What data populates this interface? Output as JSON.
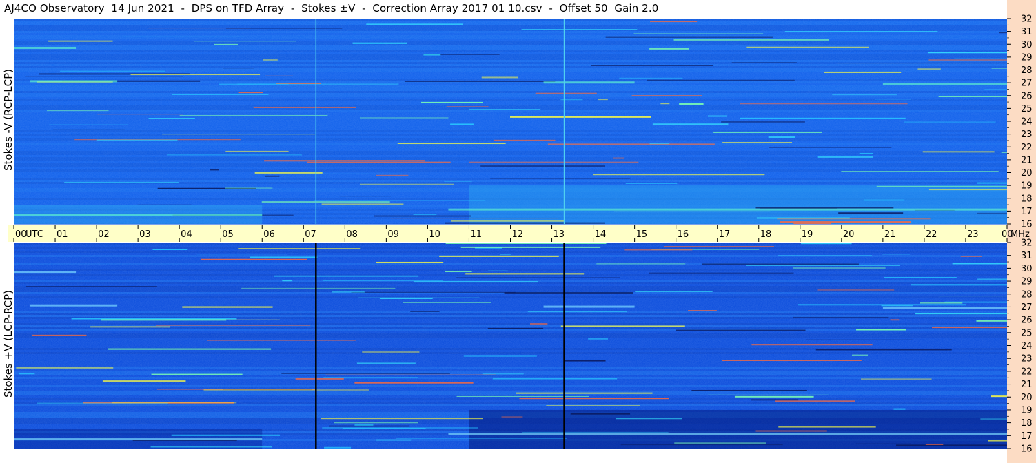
{
  "window": {
    "title": "AJ4CO Observatory  14 Jun 2021  -  DPS on TFD Array  -  Stokes ±V  -  Correction Array 2017 01 10.csv  -  Offset 50  Gain 2.0"
  },
  "colors": {
    "background": "#0a5ae6",
    "band_bg": "#ffffc8",
    "right_strip": "#fcdcc4",
    "marker_top": "#4fd0f0",
    "marker_bottom": "#000000"
  },
  "chart_data": [
    {
      "type": "heatmap",
      "panel": "top",
      "ylabel": "Stokes -V (RCP-LCP)",
      "y_unit": "MHz",
      "ylim": [
        16,
        32
      ],
      "y_ticks": [
        "32",
        "31",
        "30",
        "29",
        "28",
        "27",
        "26",
        "25",
        "24",
        "23",
        "22",
        "21",
        "20",
        "19",
        "18",
        "17",
        "16"
      ],
      "x_range_utc": [
        0,
        24
      ],
      "marker_lines_utc": [
        7.3,
        13.3
      ],
      "colormap": "blue-cyan-yellow-red"
    },
    {
      "type": "heatmap",
      "panel": "bottom",
      "ylabel": "Stokes +V (LCP-RCP)",
      "y_unit": "MHz",
      "ylim": [
        16,
        32
      ],
      "y_ticks": [
        "32",
        "31",
        "30",
        "29",
        "28",
        "27",
        "26",
        "25",
        "24",
        "23",
        "22",
        "21",
        "20",
        "19",
        "18",
        "17",
        "16"
      ],
      "x_range_utc": [
        0,
        24
      ],
      "marker_lines_utc": [
        7.3,
        13.3
      ],
      "colormap": "blue-cyan-yellow-red"
    }
  ],
  "time_axis": {
    "labels": [
      "00",
      "01",
      "02",
      "03",
      "04",
      "05",
      "06",
      "07",
      "08",
      "09",
      "10",
      "11",
      "12",
      "13",
      "14",
      "15",
      "16",
      "17",
      "18",
      "19",
      "20",
      "21",
      "22",
      "23",
      "00"
    ],
    "utc_label": "UTC",
    "mhz_label": "MHz"
  }
}
